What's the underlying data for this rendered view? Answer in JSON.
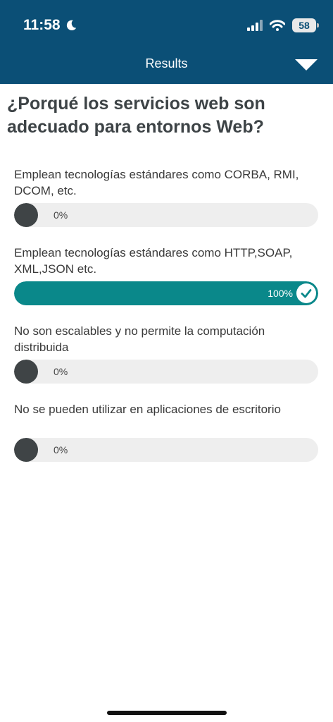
{
  "status_bar": {
    "time": "11:58",
    "battery": "58"
  },
  "header": {
    "title": "Results"
  },
  "question": "¿Porqué los servicios web son adecuado para entornos Web?",
  "options": [
    {
      "label": "Emplean tecnologías estándares como CORBA, RMI, DCOM, etc.",
      "percent_text": "0%",
      "percent": 0,
      "selected": false
    },
    {
      "label": "Emplean tecnologías estándares como HTTP,SOAP, XML,JSON etc.",
      "percent_text": "100%",
      "percent": 100,
      "selected": true
    },
    {
      "label": "No son escalables y no permite la computación distribuida",
      "percent_text": "0%",
      "percent": 0,
      "selected": false
    },
    {
      "label": "No se pueden utilizar en aplicaciones de escritorio",
      "percent_text": "0%",
      "percent": 0,
      "selected": false
    }
  ],
  "colors": {
    "header_bg": "#0b4f76",
    "bar_fill": "#0a888a",
    "bar_track": "#eeeeee",
    "empty_dot": "#3f4446"
  },
  "icons": [
    "moon-icon",
    "signal-icon",
    "wifi-icon",
    "battery-icon",
    "chevron-down-icon",
    "check-icon"
  ]
}
